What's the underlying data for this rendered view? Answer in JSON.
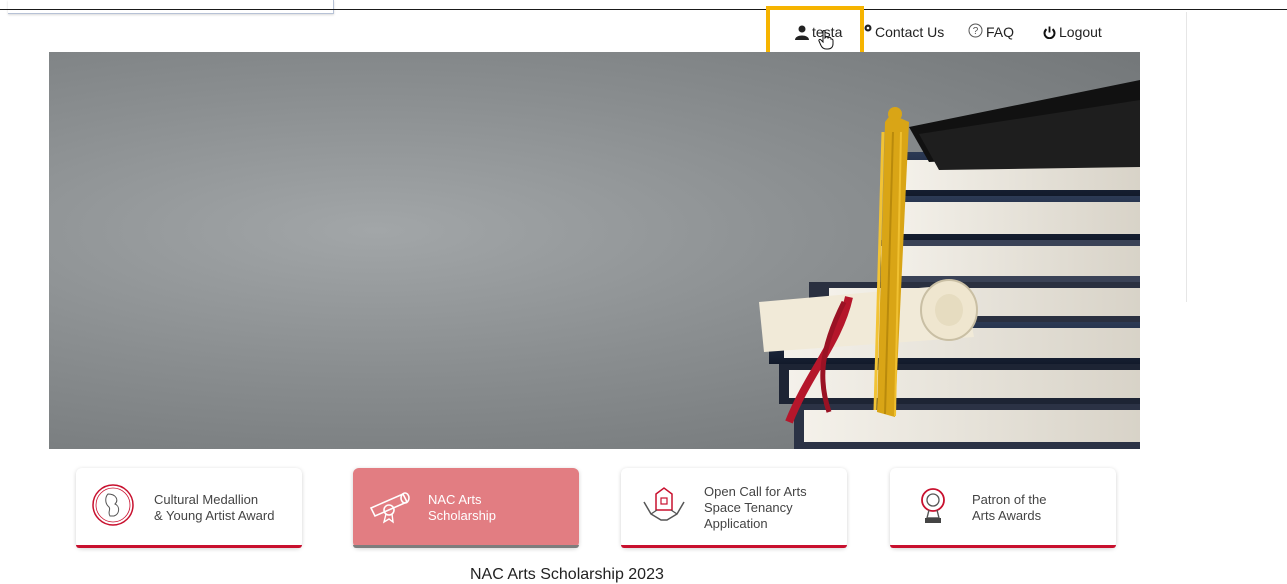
{
  "header": {
    "user_label": "testa",
    "contact_label": "Contact Us",
    "faq_label": "FAQ",
    "logout_label": "Logout"
  },
  "cards": [
    {
      "lines": [
        "Cultural Medallion",
        "& Young Artist Award"
      ],
      "icon": "medallion-icon",
      "active": false
    },
    {
      "lines": [
        "NAC Arts",
        "Scholarship"
      ],
      "icon": "diploma-icon",
      "active": true
    },
    {
      "lines": [
        "Open Call for Arts",
        "Space Tenancy",
        "Application"
      ],
      "icon": "building-hands-icon",
      "active": false
    },
    {
      "lines": [
        "Patron of the",
        "Arts Awards"
      ],
      "icon": "trophy-icon",
      "active": false
    }
  ],
  "section": {
    "title": "NAC Arts Scholarship 2023"
  },
  "colors": {
    "accent_red": "#c8102e",
    "active_card": "#e27d82",
    "highlight": "#f6b400"
  }
}
